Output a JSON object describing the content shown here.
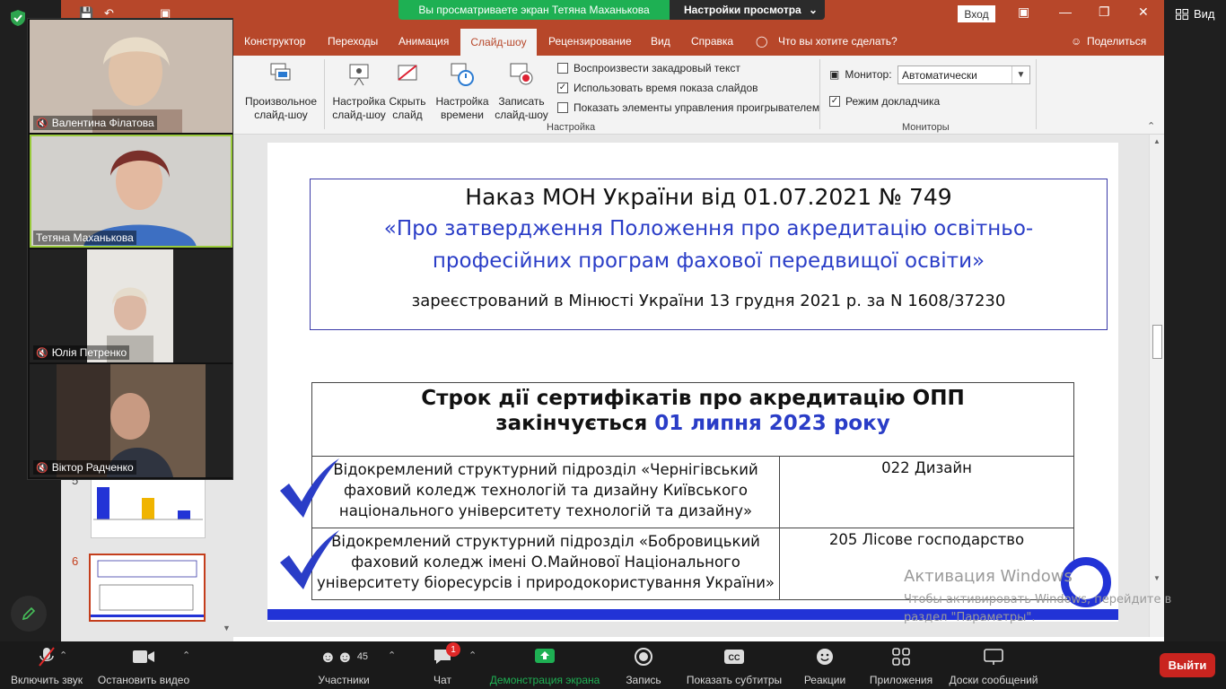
{
  "share": {
    "banner": "Вы просматриваете экран Тетяна Маханькова",
    "settings": "Настройки просмотра"
  },
  "zoom_right": {
    "view_label": "Вид"
  },
  "ppt": {
    "title_login": "Вход",
    "tabs": [
      "Конструктор",
      "Переходы",
      "Анимация",
      "Слайд-шоу",
      "Рецензирование",
      "Вид",
      "Справка"
    ],
    "active_tab": "Слайд-шоу",
    "tell_me": "Что вы хотите сделать?",
    "share": "Поделиться",
    "ribbon": {
      "custom_show": "Произвольное слайд-шоу",
      "setup_show": "Настройка слайд-шоу",
      "hide_slide": "Скрыть слайд",
      "rehearse": "Настройка времени",
      "record": "Записать слайд-шоу",
      "check_narration": "Воспроизвести закадровый текст",
      "check_timings": "Использовать время показа слайдов",
      "check_media": "Показать элементы управления проигрывателем",
      "group_setup": "Настройка",
      "monitor_label": "Монитор:",
      "monitor_value": "Автоматически",
      "presenter_view": "Режим докладчика",
      "group_monitors": "Мониторы"
    },
    "thumb_numbers": [
      "5",
      "6"
    ]
  },
  "slide": {
    "title_line": "Наказ МОН України від 01.07.2021 № 749",
    "quote_line1": "«Про затвердження Положення про акредитацію освітньо-",
    "quote_line2": "професійних програм фахової передвищої освіти»",
    "registered": "зареєстрований в Мінюсті України 13 грудня 2021 р. за N 1608/37230",
    "table_header_line1": "Строк дії сертифікатів про акредитацію ОПП",
    "table_header_line2a": "закінчується",
    "table_header_line2b": "01 липня 2023 року",
    "rows": [
      {
        "institution": "Відокремлений структурний підрозділ «Чернігівський фаховий коледж технологій та дизайну Київського національного університету технологій та дизайну»",
        "program": "022 Дизайн"
      },
      {
        "institution": "Відокремлений структурний підрозділ «Бобровицький фаховий коледж імені О.Майнової Національного університету біоресурсів і природокористування України»",
        "program": "205 Лісове господарство"
      }
    ]
  },
  "watermark": {
    "line1": "Активация Windows",
    "line2": "Чтобы активировать Windows, перейдите в",
    "line3": "раздел \"Параметры\"."
  },
  "participants": [
    {
      "name": "Валентина Філатова",
      "muted": true
    },
    {
      "name": "Тетяна Маханькова",
      "muted": false
    },
    {
      "name": "Юлія Петренко",
      "muted": true
    },
    {
      "name": "Віктор Радченко",
      "muted": true
    }
  ],
  "toolbar": {
    "unmute": "Включить звук",
    "stop_video": "Остановить видео",
    "participants": "Участники",
    "participants_count": "45",
    "chat": "Чат",
    "chat_badge": "1",
    "share_screen": "Демонстрация экрана",
    "record": "Запись",
    "captions": "Показать субтитры",
    "reactions": "Реакции",
    "apps": "Приложения",
    "whiteboards": "Доски сообщений",
    "leave": "Выйти"
  },
  "colors": {
    "ppt_accent": "#b7472a",
    "slide_blue": "#2a3dc7",
    "zoom_green": "#1eb053",
    "leave_red": "#c9241f"
  }
}
